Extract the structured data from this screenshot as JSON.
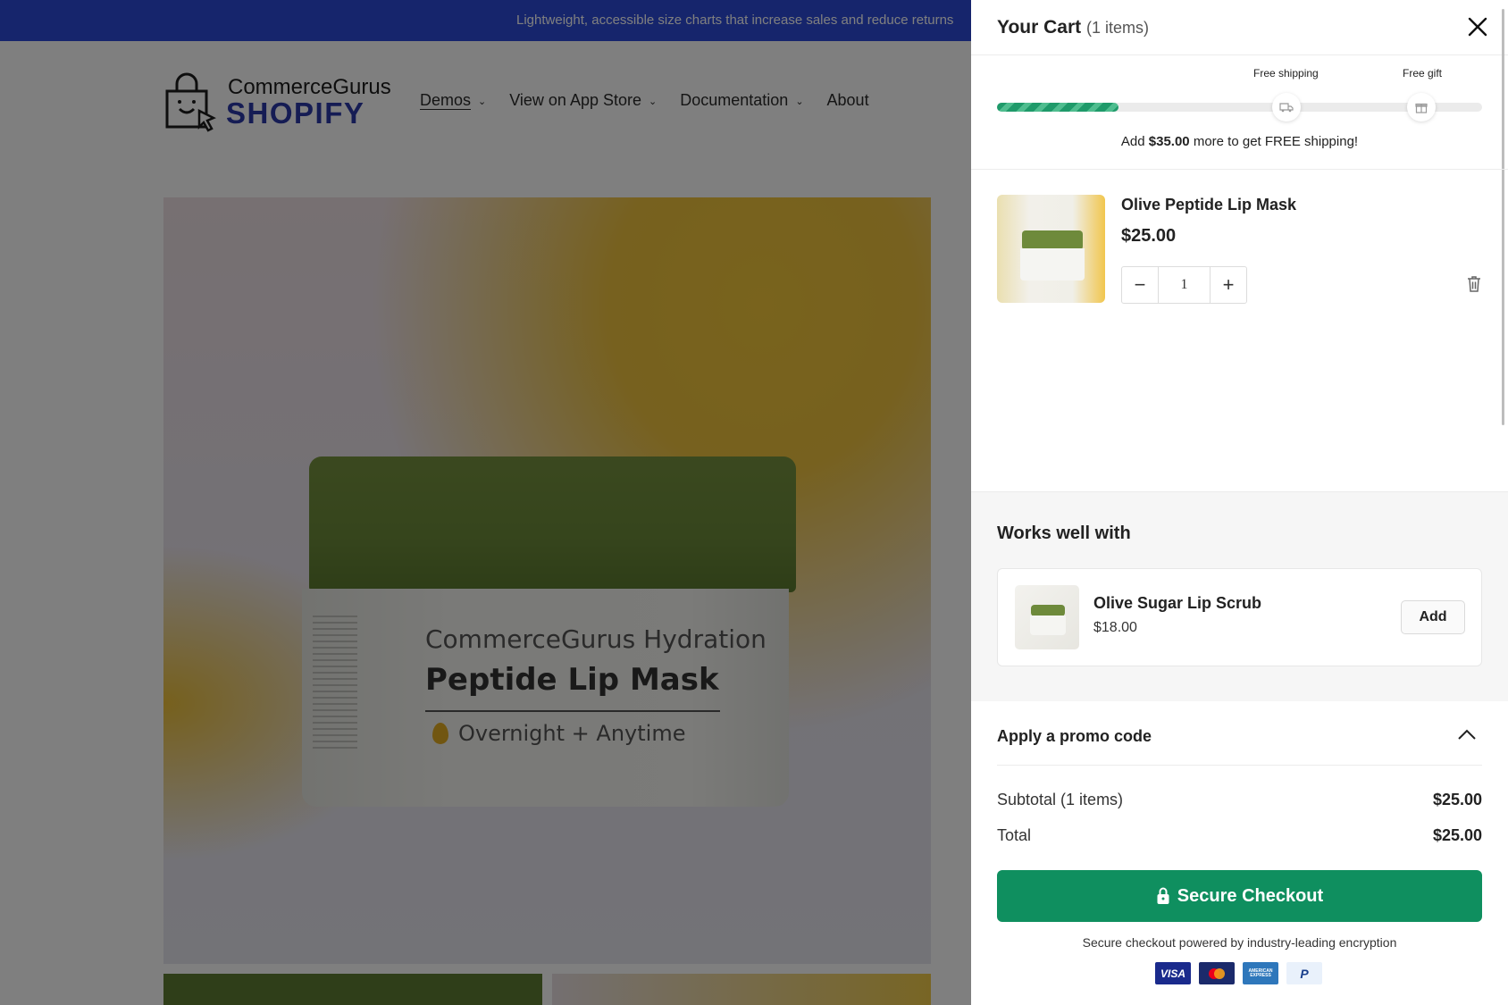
{
  "announcement": "Lightweight, accessible size charts that increase sales and reduce returns",
  "logo": {
    "line1": "CommerceGurus",
    "line2": "SHOPIFY"
  },
  "nav": [
    {
      "label": "Demos",
      "has_dropdown": true,
      "active": true
    },
    {
      "label": "View on App Store",
      "has_dropdown": true
    },
    {
      "label": "Documentation",
      "has_dropdown": true
    },
    {
      "label": "About",
      "has_dropdown": false
    }
  ],
  "product_image": {
    "line1": "CommerceGurus Hydration",
    "line2": "Peptide Lip Mask",
    "line3": "Overnight + Anytime"
  },
  "cart": {
    "title": "Your Cart",
    "count": "(1 items)",
    "progress": {
      "milestone1_label": "Free shipping",
      "milestone2_label": "Free gift",
      "fill_fraction": 0.25,
      "message_prefix": "Add",
      "message_amount": "$35.00",
      "message_suffix": "more to get FREE shipping!"
    },
    "item": {
      "name": "Olive Peptide Lip Mask",
      "price": "$25.00",
      "quantity": "1",
      "minus": "−",
      "plus": "+"
    },
    "upsell": {
      "title": "Works well with",
      "name": "Olive Sugar Lip Scrub",
      "price": "$18.00",
      "add_label": "Add"
    },
    "promo_label": "Apply a promo code",
    "subtotal_label": "Subtotal (1 items)",
    "subtotal_value": "$25.00",
    "total_label": "Total",
    "total_value": "$25.00",
    "checkout_label": "Secure Checkout",
    "secure_note": "Secure checkout powered by industry-leading encryption",
    "payment_methods": [
      "VISA",
      "Mastercard",
      "AMERICAN EXPRESS",
      "PayPal"
    ]
  },
  "colors": {
    "announcement_bg": "#2c4ad8",
    "checkout_bg": "#0f8f5f",
    "progress_fill": "#1f9a6a"
  }
}
